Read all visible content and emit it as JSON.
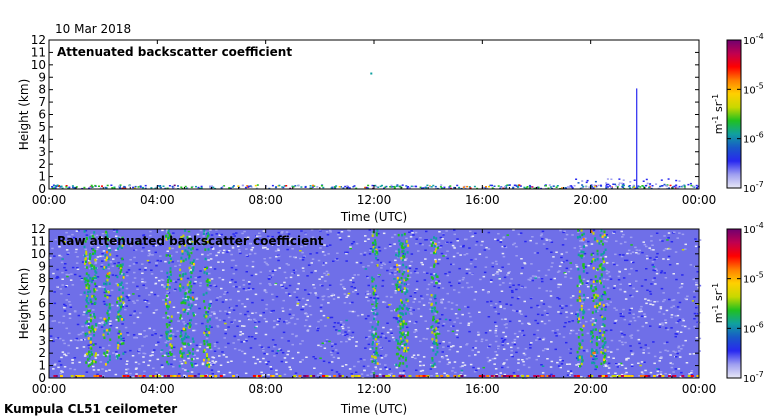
{
  "date_label": "10 Mar 2018",
  "footer_label": "Kumpula CL51 ceilometer",
  "colormap": [
    "#e8e8f6",
    "#9f9ff0",
    "#2828f0",
    "#1858c8",
    "#10a0a0",
    "#20c020",
    "#c8d800",
    "#ffd000",
    "#ff8000",
    "#ff0000",
    "#c00050",
    "#700070"
  ],
  "chart_data": [
    {
      "type": "heatmap",
      "title": "Attenuated backscatter coefficient",
      "xlabel": "Time (UTC)",
      "ylabel": "Height (km)",
      "x_ticks": [
        "00:00",
        "04:00",
        "08:00",
        "12:00",
        "16:00",
        "20:00",
        "00:00"
      ],
      "y_ticks": [
        "0",
        "1",
        "2",
        "3",
        "4",
        "5",
        "6",
        "7",
        "8",
        "9",
        "10",
        "11",
        "12"
      ],
      "xlim_hours": [
        0,
        24
      ],
      "ylim_km": [
        0,
        12
      ],
      "colorbar": {
        "label_parts": [
          "m",
          "-1",
          " sr",
          "-1"
        ],
        "ticks": [
          {
            "base": "10",
            "exp": "-7"
          },
          {
            "base": "10",
            "exp": "-6"
          },
          {
            "base": "10",
            "exp": "-5"
          },
          {
            "base": "10",
            "exp": "-4"
          }
        ],
        "scale": "log",
        "range": [
          1e-07,
          0.0001
        ]
      },
      "features": [
        {
          "kind": "surface_layer",
          "hours": [
            0,
            24
          ],
          "height_km": [
            0,
            0.3
          ]
        },
        {
          "kind": "cloud_column",
          "hour": 21.7,
          "height_km": [
            0,
            8.1
          ]
        },
        {
          "kind": "isolated_point",
          "hour": 11.9,
          "height_km": 9.3
        }
      ]
    },
    {
      "type": "heatmap",
      "title": "Raw attenuated backscatter coefficient",
      "xlabel": "Time (UTC)",
      "ylabel": "Height (km)",
      "x_ticks": [
        "00:00",
        "04:00",
        "08:00",
        "12:00",
        "16:00",
        "20:00",
        "00:00"
      ],
      "y_ticks": [
        "0",
        "1",
        "2",
        "3",
        "4",
        "5",
        "6",
        "7",
        "8",
        "9",
        "10",
        "11",
        "12"
      ],
      "xlim_hours": [
        0,
        24
      ],
      "ylim_km": [
        0,
        12
      ],
      "colorbar": {
        "label_parts": [
          "m",
          "-1",
          " sr",
          "-1"
        ],
        "ticks": [
          {
            "base": "10",
            "exp": "-7"
          },
          {
            "base": "10",
            "exp": "-6"
          },
          {
            "base": "10",
            "exp": "-5"
          },
          {
            "base": "10",
            "exp": "-4"
          }
        ],
        "scale": "log",
        "range": [
          1e-07,
          0.0001
        ]
      },
      "features": [
        {
          "kind": "noise_field",
          "hours": [
            0,
            24
          ],
          "height_km": [
            0,
            12
          ]
        },
        {
          "kind": "streaks",
          "hours": [
            1.4,
            1.6,
            2.1,
            2.6,
            4.4,
            4.9,
            5.2,
            5.8,
            12.0,
            12.9,
            13.1,
            14.2,
            19.6,
            20.1,
            20.4
          ]
        }
      ]
    }
  ]
}
